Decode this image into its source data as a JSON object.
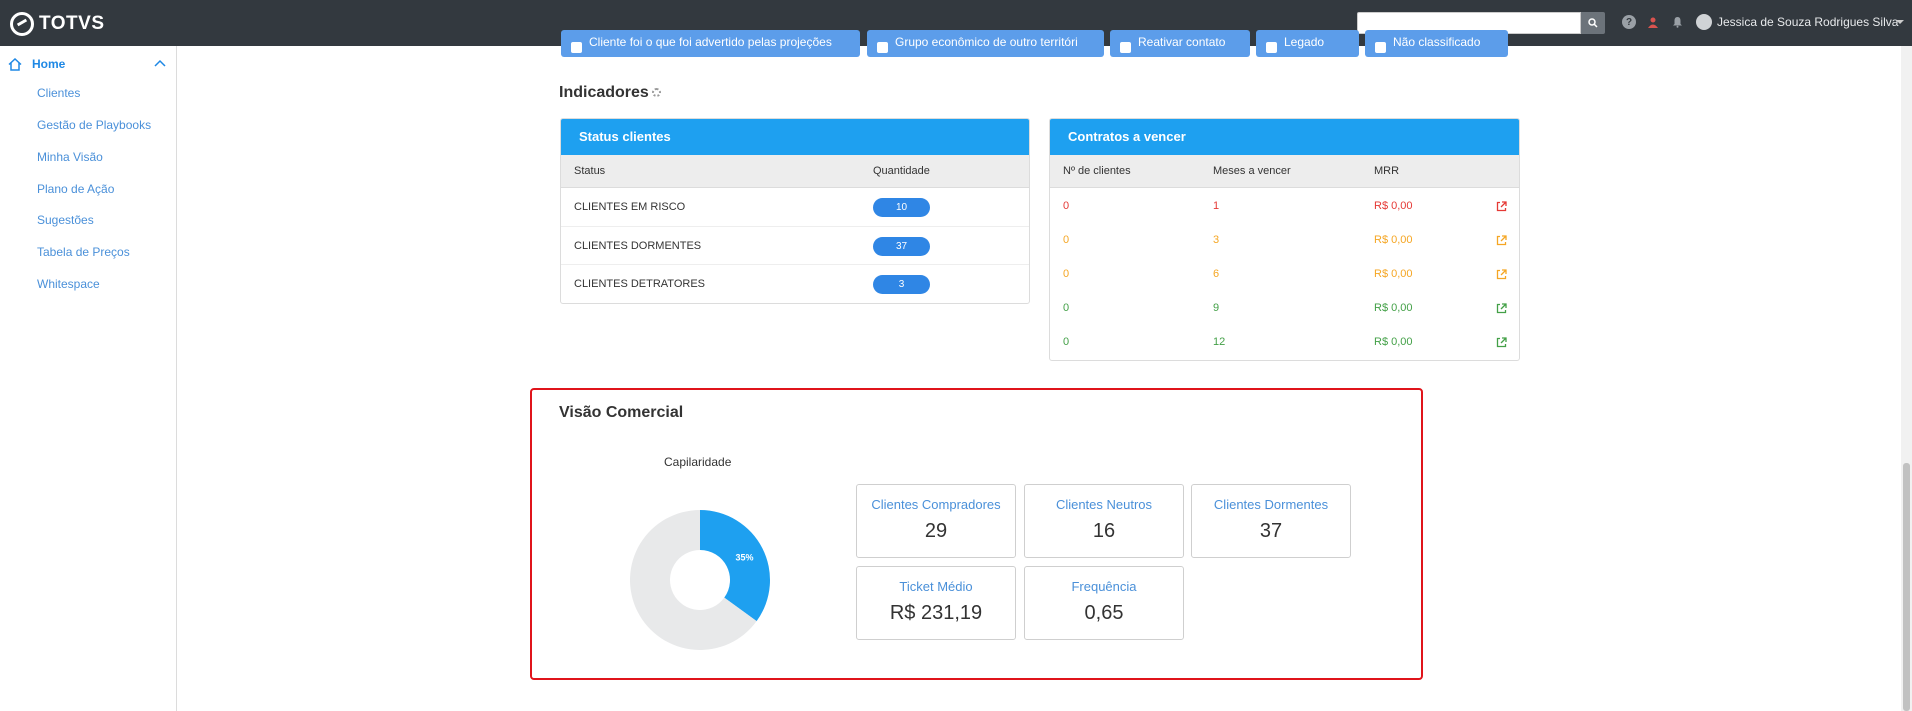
{
  "topbar": {
    "logo_text": "TOTVS",
    "search_placeholder": "",
    "user_name": "Jessica de Souza Rodrigues Silva"
  },
  "sidebar": {
    "home_label": "Home",
    "items": [
      {
        "label": "Clientes"
      },
      {
        "label": "Gestão de Playbooks"
      },
      {
        "label": "Minha Visão"
      },
      {
        "label": "Plano de Ação"
      },
      {
        "label": "Sugestões"
      },
      {
        "label": "Tabela de Preços"
      },
      {
        "label": "Whitespace"
      }
    ]
  },
  "top_filters": [
    {
      "label": "Cliente foi o que foi advertido pelas projeções"
    },
    {
      "label": "Grupo econômico de outro territóri"
    },
    {
      "label": "Reativar contato"
    },
    {
      "label": "Legado"
    },
    {
      "label": "Não classificado"
    }
  ],
  "indicadores": {
    "title": "Indicadores",
    "status_card": {
      "title": "Status clientes",
      "col_status": "Status",
      "col_qty": "Quantidade",
      "rows": [
        {
          "status": "CLIENTES EM RISCO",
          "qty": "10"
        },
        {
          "status": "CLIENTES DORMENTES",
          "qty": "37"
        },
        {
          "status": "CLIENTES DETRATORES",
          "qty": "3"
        }
      ]
    },
    "contracts_card": {
      "title": "Contratos a vencer",
      "col_clients": "Nº de clientes",
      "col_months": "Meses a vencer",
      "col_mrr": "MRR",
      "rows": [
        {
          "clients": "0",
          "months": "1",
          "mrr": "R$ 0,00",
          "color": "#e53935"
        },
        {
          "clients": "0",
          "months": "3",
          "mrr": "R$ 0,00",
          "color": "#f5a623"
        },
        {
          "clients": "0",
          "months": "6",
          "mrr": "R$ 0,00",
          "color": "#f5a623"
        },
        {
          "clients": "0",
          "months": "9",
          "mrr": "R$ 0,00",
          "color": "#43a047"
        },
        {
          "clients": "0",
          "months": "12",
          "mrr": "R$ 0,00",
          "color": "#43a047"
        }
      ]
    }
  },
  "visao_comercial": {
    "title": "Visão Comercial",
    "kpis": {
      "compradores": {
        "label": "Clientes Compradores",
        "value": "29"
      },
      "neutros": {
        "label": "Clientes Neutros",
        "value": "16"
      },
      "dormentes": {
        "label": "Clientes Dormentes",
        "value": "37"
      },
      "ticket": {
        "label": "Ticket Médio",
        "value": "R$ 231,19"
      },
      "frequencia": {
        "label": "Frequência",
        "value": "0,65"
      }
    }
  },
  "chart_data": {
    "type": "pie",
    "title": "Capilaridade",
    "slices": [
      {
        "value": 35,
        "label": "35%",
        "color": "#1ea0f0"
      },
      {
        "value": 65,
        "label": "",
        "color": "#e8e9ea"
      }
    ]
  },
  "colors": {
    "accent": "#1ea0f0",
    "topbar": "#33393f",
    "highlight_border": "#e0141b"
  }
}
